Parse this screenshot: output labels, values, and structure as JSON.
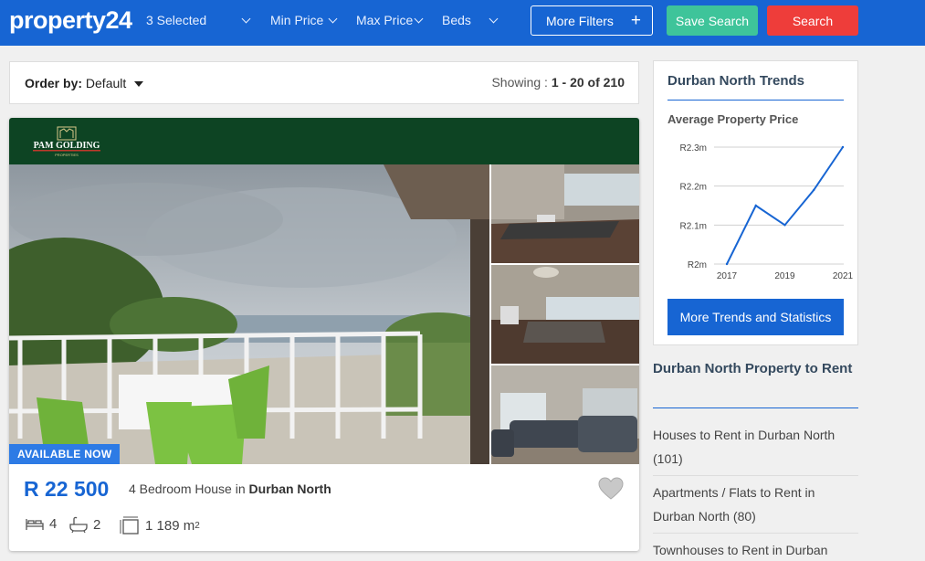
{
  "header": {
    "logo": "property24",
    "filters": [
      "3 Selected",
      "Min Price",
      "Max Price",
      "Beds"
    ],
    "more_filters": "More Filters",
    "more_filters_icon": "plus-icon",
    "save_search": "Save Search",
    "search": "Search",
    "colors": {
      "bar": "#1765d3",
      "save": "#3ec49a",
      "search": "#ee3d3a"
    }
  },
  "order": {
    "label": "Order by:",
    "value": "Default",
    "showing_prefix": "Showing :",
    "showing_range": "1 - 20 of 210"
  },
  "listing": {
    "agency": "PAM GOLDING",
    "agency_sub": "PROPERTIES",
    "badge": "AVAILABLE NOW",
    "price": "R 22 500",
    "title_prefix": "4 Bedroom House in",
    "title_location": "Durban North",
    "bedrooms": "4",
    "bathrooms": "2",
    "size": "1 189 m",
    "size_sup": "2"
  },
  "trends": {
    "title": "Durban North Trends",
    "subtitle": "Average Property Price",
    "button": "More Trends and Statistics"
  },
  "chart_data": {
    "type": "line",
    "title": "Average Property Price",
    "x": [
      2017,
      2018,
      2019,
      2020,
      2021
    ],
    "x_tick_labels": [
      "2017",
      "2019",
      "2021"
    ],
    "y_tick_labels": [
      "R2.3m",
      "R2.2m",
      "R2.1m",
      "R2m"
    ],
    "y_ticks": [
      2.3,
      2.2,
      2.1,
      2.0
    ],
    "ylim": [
      2.0,
      2.3
    ],
    "series": [
      {
        "values": [
          2.0,
          2.15,
          2.1,
          2.19,
          2.3
        ]
      }
    ],
    "grid": true,
    "color": "#1765d3"
  },
  "rent": {
    "title": "Durban North Property to Rent",
    "links": [
      "Houses to Rent in Durban North (101)",
      "Apartments / Flats to Rent in Durban North (80)",
      "Townhouses to Rent in Durban"
    ]
  }
}
